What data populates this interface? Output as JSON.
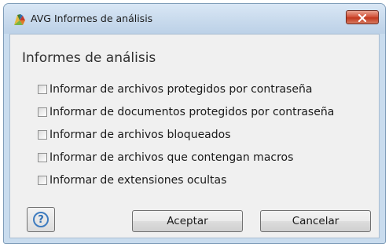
{
  "window": {
    "title": "AVG Informes de análisis",
    "app_icon": "avg-logo-icon",
    "close_icon": "close-icon"
  },
  "dialog": {
    "heading": "Informes de análisis",
    "options": [
      {
        "label": "Informar de archivos protegidos por contraseña",
        "checked": false
      },
      {
        "label": "Informar de documentos protegidos por contraseña",
        "checked": false
      },
      {
        "label": "Informar de archivos bloqueados",
        "checked": false
      },
      {
        "label": "Informar de archivos que contengan macros",
        "checked": false
      },
      {
        "label": "Informar de extensiones ocultas",
        "checked": false
      }
    ],
    "help_icon": "help-icon",
    "help_glyph": "?",
    "ok_label": "Aceptar",
    "cancel_label": "Cancelar"
  }
}
